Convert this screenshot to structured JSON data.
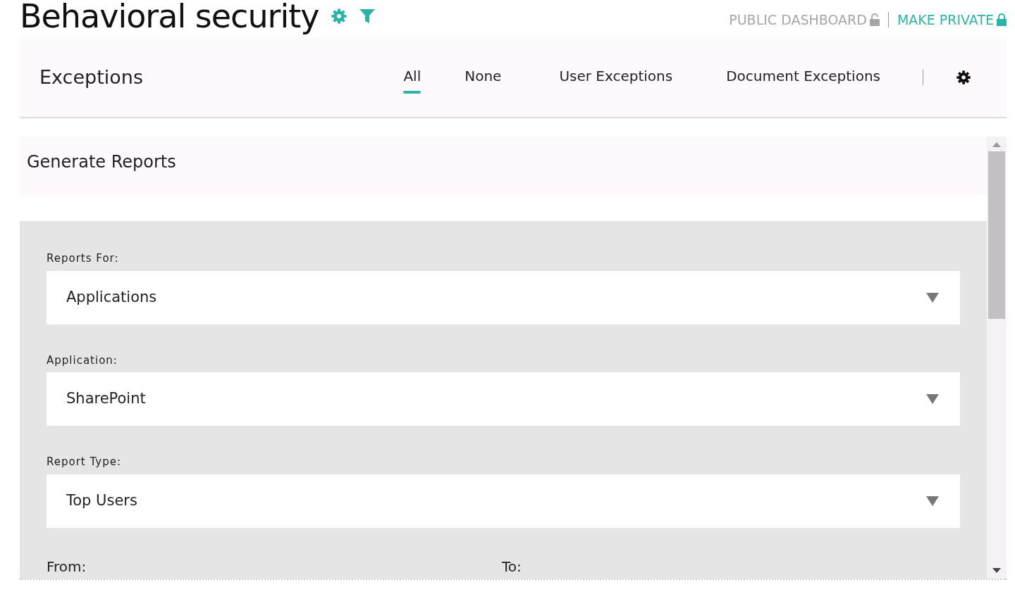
{
  "title": "Behavioral security",
  "header_links": [
    {
      "label": "PUBLIC DASHBOARD",
      "kind": "muted"
    },
    {
      "label": "MAKE PRIVATE",
      "kind": "accent"
    }
  ],
  "exceptions": {
    "title": "Exceptions",
    "tabs": [
      {
        "label": "All",
        "selected": true
      },
      {
        "label": "None",
        "selected": false
      },
      {
        "label": "User Exceptions",
        "selected": false
      },
      {
        "label": "Document Exceptions",
        "selected": false
      }
    ]
  },
  "reports": {
    "title": "Generate Reports",
    "fields": [
      {
        "label": "Reports For:",
        "value": "Applications"
      },
      {
        "label": "Application:",
        "value": "SharePoint"
      },
      {
        "label": "Report Type:",
        "value": "Top Users"
      }
    ],
    "date_labels": [
      "From:",
      "To:"
    ]
  }
}
